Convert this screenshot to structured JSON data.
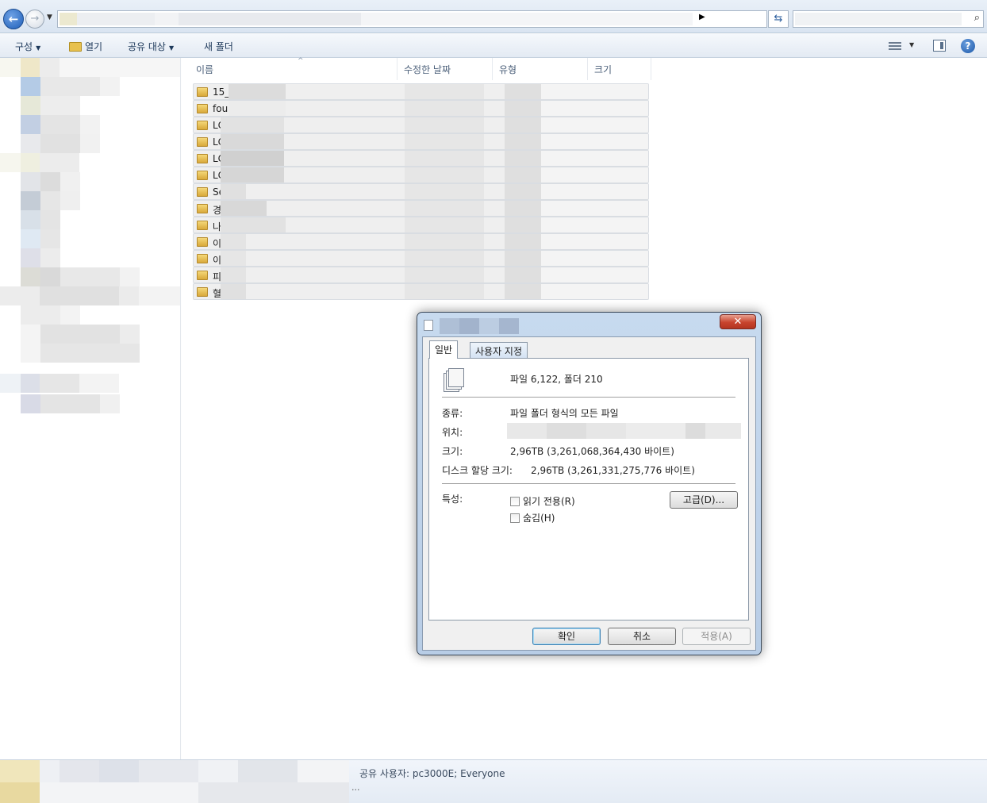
{
  "address_bar": {
    "back_glyph": "←",
    "forward_glyph": "→",
    "refresh_glyph": "⇆",
    "search_glyph": "⌕"
  },
  "toolbar": {
    "organize": "구성",
    "open": "열기",
    "share_with": "공유 대상",
    "new_folder": "새 폴더",
    "help": "?"
  },
  "columns": {
    "name": "이름",
    "date_modified": "수정한 날짜",
    "type": "유형",
    "size": "크기"
  },
  "rows": [
    "15_",
    "fou",
    "LC",
    "LC",
    "LC",
    "LC",
    "Se",
    "경",
    "나",
    "이",
    "이",
    "피",
    "혈"
  ],
  "status_bar": {
    "shared_with": "공유 사용자: pc3000E; Everyone",
    "ellipsis": "..."
  },
  "dialog": {
    "close_glyph": "✕",
    "tabs": {
      "general": "일반",
      "custom": "사용자 지정"
    },
    "summary": "파일 6,122, 폴더 210",
    "type_label": "종류:",
    "type_value": "파일 폴더 형식의 모든 파일",
    "location_label": "위치:",
    "size_label": "크기:",
    "size_value": "2,96TB (3,261,068,364,430 바이트)",
    "size_on_disk_label": "디스크 할당 크기:",
    "size_on_disk_value": "2,96TB (3,261,331,275,776 바이트)",
    "attributes_label": "특성:",
    "readonly_label": "읽기 전용(R)",
    "hidden_label": "숨김(H)",
    "advanced_button": "고급(D)...",
    "ok_button": "확인",
    "cancel_button": "취소",
    "apply_button": "적용(A)"
  }
}
